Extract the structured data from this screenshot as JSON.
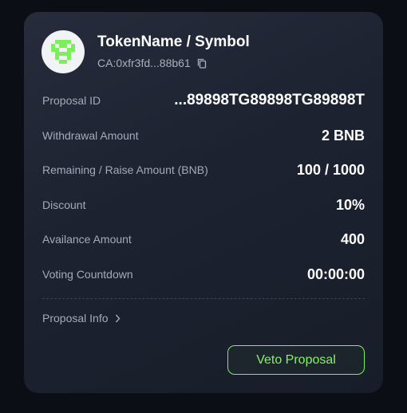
{
  "token": {
    "name": "TokenName / Symbol",
    "contract": "CA:0xfr3fd...88b61",
    "icon": "pixel-token-icon",
    "icon_color": "#7cf05b"
  },
  "details": [
    {
      "label": "Proposal ID",
      "value": "...89898TG89898TG89898T"
    },
    {
      "label": "Withdrawal Amount",
      "value": "2 BNB"
    },
    {
      "label": "Remaining / Raise Amount (BNB)",
      "value": "100 / 1000"
    },
    {
      "label": "Discount",
      "value": "10%"
    },
    {
      "label": "Availance Amount",
      "value": "400"
    },
    {
      "label": "Voting Countdown",
      "value": "00:00:00"
    }
  ],
  "proposal_info_label": "Proposal Info",
  "veto_button_label": "Veto Proposal",
  "colors": {
    "accent": "#7cf05b",
    "background": "#0b0e15",
    "card": "#1e2432"
  }
}
